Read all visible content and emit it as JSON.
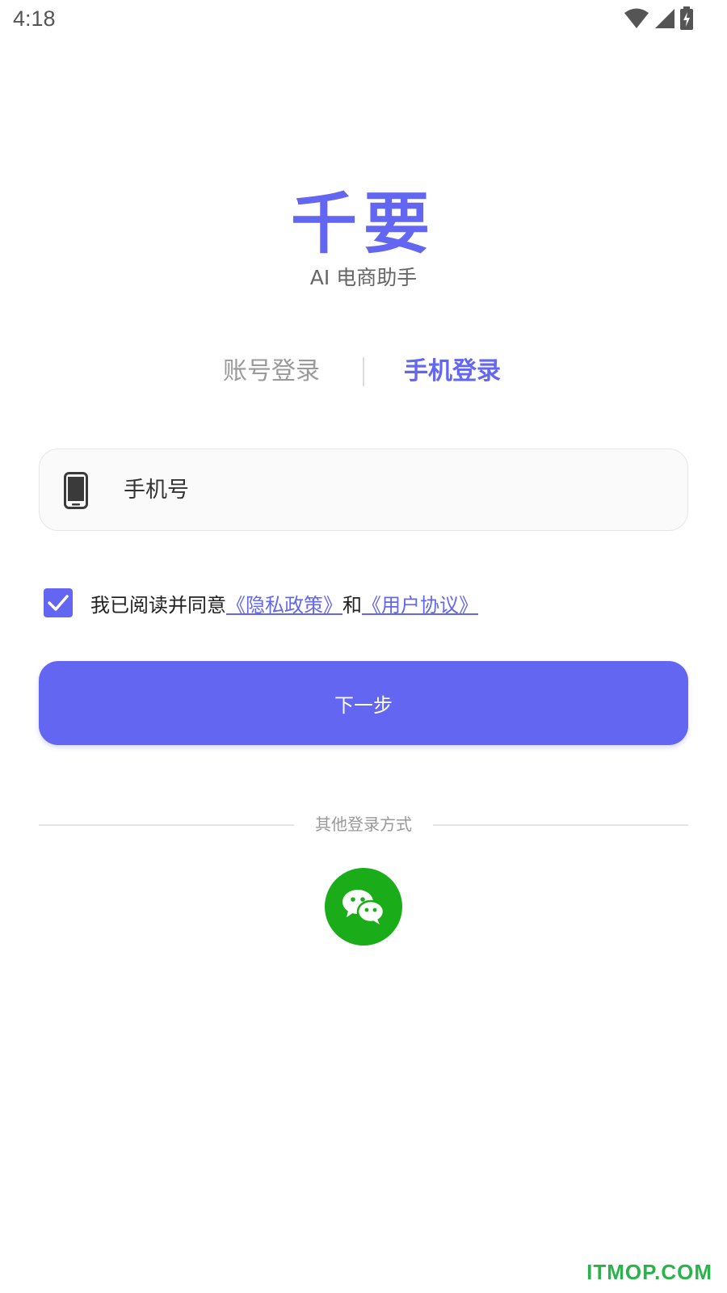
{
  "status_bar": {
    "time": "4:18"
  },
  "app": {
    "title": "千要",
    "subtitle": "AI 电商助手"
  },
  "tabs": [
    {
      "label": "账号登录",
      "active": false
    },
    {
      "label": "手机登录",
      "active": true
    }
  ],
  "phone_field": {
    "placeholder": "手机号",
    "value": "",
    "icon": "smartphone-icon"
  },
  "agreement": {
    "checked": true,
    "prefix": "我已阅读并同意",
    "privacy_link": "《隐私政策》",
    "conjunction": "和",
    "terms_link": "《用户协议》"
  },
  "next_button": {
    "label": "下一步"
  },
  "other_login": {
    "label": "其他登录方式",
    "wechat_icon": "wechat-icon"
  },
  "watermark": "ITMOP.COM",
  "colors": {
    "accent": "#6366f1",
    "wechat": "#1aad19",
    "watermark": "#2bb24c"
  }
}
